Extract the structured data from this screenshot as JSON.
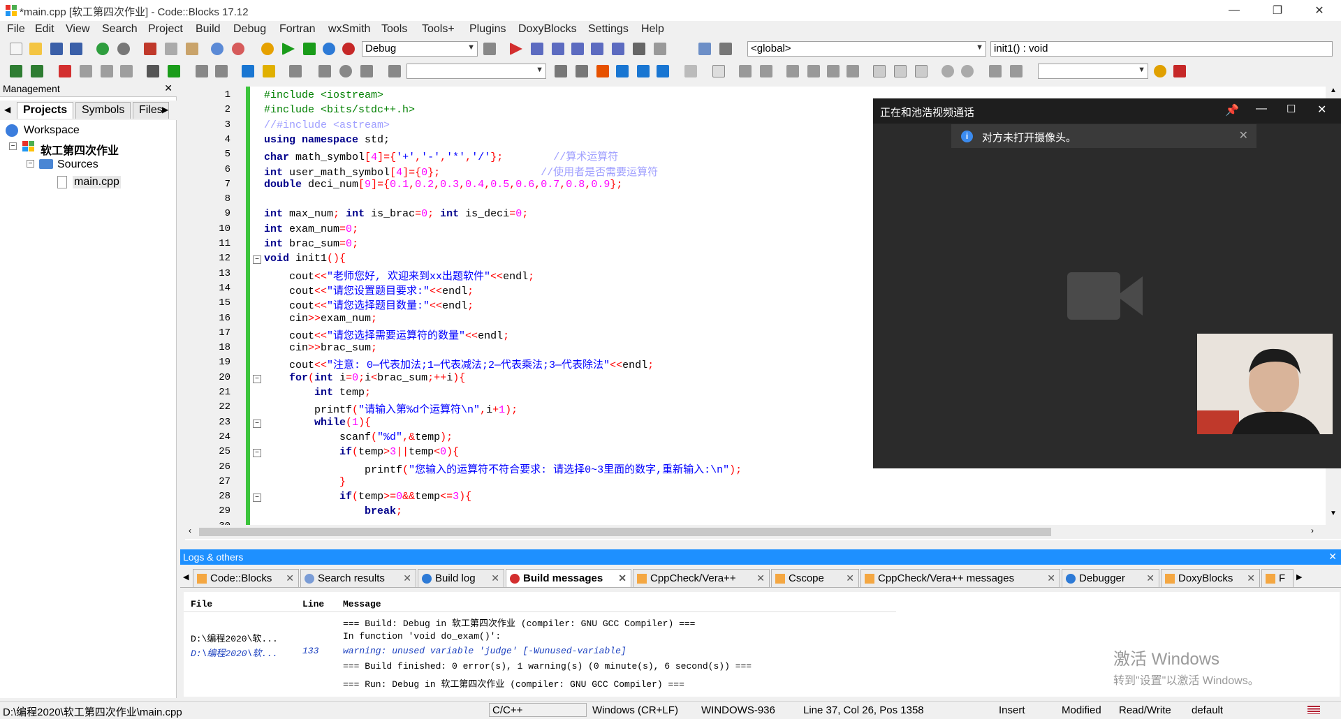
{
  "window": {
    "title": "*main.cpp [软工第四次作业] - Code::Blocks 17.12",
    "minimize": "—",
    "maximize": "❐",
    "close": "✕"
  },
  "menu": [
    "File",
    "Edit",
    "View",
    "Search",
    "Project",
    "Build",
    "Debug",
    "Fortran",
    "wxSmith",
    "Tools",
    "Tools+",
    "Plugins",
    "DoxyBlocks",
    "Settings",
    "Help"
  ],
  "toolbar": {
    "build_target": "Debug",
    "scope": "<global>",
    "symbol": "init1() : void"
  },
  "management": {
    "title": "Management",
    "tabs": [
      "Projects",
      "Symbols",
      "Files"
    ],
    "tree": {
      "workspace": "Workspace",
      "project": "软工第四次作业",
      "sources": "Sources",
      "file": "main.cpp"
    }
  },
  "editor": {
    "lines": [
      {
        "n": "1",
        "html": "<span class=\"pp\">#include &lt;iostream&gt;</span>"
      },
      {
        "n": "2",
        "html": "<span class=\"pp\">#include &lt;bits/stdc++.h&gt;</span>"
      },
      {
        "n": "3",
        "html": "<span class=\"cm\">//#include &lt;astream&gt;</span>"
      },
      {
        "n": "4",
        "html": "<span class=\"kw\">using namespace</span> std;"
      },
      {
        "n": "5",
        "html": "<span class=\"kw\">char</span> math_symbol<span class=\"op\">[</span><span class=\"num\">4</span><span class=\"op\">]={</span><span class=\"str\">'+'</span><span class=\"op\">,</span><span class=\"str\">'-'</span><span class=\"op\">,</span><span class=\"str\">'*'</span><span class=\"op\">,</span><span class=\"str\">'/'</span><span class=\"op\">};</span>        <span class=\"cm\">//算术运算符</span>"
      },
      {
        "n": "6",
        "html": "<span class=\"kw\">int</span> user_math_symbol<span class=\"op\">[</span><span class=\"num\">4</span><span class=\"op\">]={</span><span class=\"num\">0</span><span class=\"op\">};</span>                <span class=\"cm\">//使用者是否需要运算符</span>"
      },
      {
        "n": "7",
        "html": "<span class=\"kw\">double</span> deci_num<span class=\"op\">[</span><span class=\"num\">9</span><span class=\"op\">]={</span><span class=\"num\">0.1</span><span class=\"op\">,</span><span class=\"num\">0.2</span><span class=\"op\">,</span><span class=\"num\">0.3</span><span class=\"op\">,</span><span class=\"num\">0.4</span><span class=\"op\">,</span><span class=\"num\">0.5</span><span class=\"op\">,</span><span class=\"num\">0.6</span><span class=\"op\">,</span><span class=\"num\">0.7</span><span class=\"op\">,</span><span class=\"num\">0.8</span><span class=\"op\">,</span><span class=\"num\">0.9</span><span class=\"op\">};</span>"
      },
      {
        "n": "8",
        "html": ""
      },
      {
        "n": "9",
        "html": "<span class=\"kw\">int</span> max_num<span class=\"op\">;</span> <span class=\"kw\">int</span> is_brac<span class=\"op\">=</span><span class=\"num\">0</span><span class=\"op\">;</span> <span class=\"kw\">int</span> is_deci<span class=\"op\">=</span><span class=\"num\">0</span><span class=\"op\">;</span>"
      },
      {
        "n": "10",
        "html": "<span class=\"kw\">int</span> exam_num<span class=\"op\">=</span><span class=\"num\">0</span><span class=\"op\">;</span>"
      },
      {
        "n": "11",
        "html": "<span class=\"kw\">int</span> brac_sum<span class=\"op\">=</span><span class=\"num\">0</span><span class=\"op\">;</span>"
      },
      {
        "n": "12",
        "html": "<span class=\"kw\">void</span> init1<span class=\"op\">(){</span>"
      },
      {
        "n": "13",
        "html": "    cout<span class=\"op\">&lt;&lt;</span><span class=\"str\">\"老师您好, 欢迎来到xx出题软件\"</span><span class=\"op\">&lt;&lt;</span>endl<span class=\"op\">;</span>"
      },
      {
        "n": "14",
        "html": "    cout<span class=\"op\">&lt;&lt;</span><span class=\"str\">\"请您设置题目要求:\"</span><span class=\"op\">&lt;&lt;</span>endl<span class=\"op\">;</span>"
      },
      {
        "n": "15",
        "html": "    cout<span class=\"op\">&lt;&lt;</span><span class=\"str\">\"请您选择题目数量:\"</span><span class=\"op\">&lt;&lt;</span>endl<span class=\"op\">;</span>"
      },
      {
        "n": "16",
        "html": "    cin<span class=\"op\">&gt;&gt;</span>exam_num<span class=\"op\">;</span>"
      },
      {
        "n": "17",
        "html": "    cout<span class=\"op\">&lt;&lt;</span><span class=\"str\">\"请您选择需要运算符的数量\"</span><span class=\"op\">&lt;&lt;</span>endl<span class=\"op\">;</span>"
      },
      {
        "n": "18",
        "html": "    cin<span class=\"op\">&gt;&gt;</span>brac_sum<span class=\"op\">;</span>"
      },
      {
        "n": "19",
        "html": "    cout<span class=\"op\">&lt;&lt;</span><span class=\"str\">\"注意: 0—代表加法;1—代表减法;2—代表乘法;3—代表除法\"</span><span class=\"op\">&lt;&lt;</span>endl<span class=\"op\">;</span>"
      },
      {
        "n": "20",
        "html": "    <span class=\"kw\">for</span><span class=\"op\">(</span><span class=\"kw\">int</span> i<span class=\"op\">=</span><span class=\"num\">0</span><span class=\"op\">;</span>i<span class=\"op\">&lt;</span>brac_sum<span class=\"op\">;++</span>i<span class=\"op\">){</span>"
      },
      {
        "n": "21",
        "html": "        <span class=\"kw\">int</span> temp<span class=\"op\">;</span>"
      },
      {
        "n": "22",
        "html": "        printf<span class=\"op\">(</span><span class=\"str\">\"请输入第%d个运算符\\n\"</span><span class=\"op\">,</span>i<span class=\"op\">+</span><span class=\"num\">1</span><span class=\"op\">);</span>"
      },
      {
        "n": "23",
        "html": "        <span class=\"kw\">while</span><span class=\"op\">(</span><span class=\"num\">1</span><span class=\"op\">){</span>"
      },
      {
        "n": "24",
        "html": "            scanf<span class=\"op\">(</span><span class=\"str\">\"%d\"</span><span class=\"op\">,&amp;</span>temp<span class=\"op\">);</span>"
      },
      {
        "n": "25",
        "html": "            <span class=\"kw\">if</span><span class=\"op\">(</span>temp<span class=\"op\">&gt;</span><span class=\"num\">3</span><span class=\"op\">||</span>temp<span class=\"op\">&lt;</span><span class=\"num\">0</span><span class=\"op\">){</span>"
      },
      {
        "n": "26",
        "html": "                printf<span class=\"op\">(</span><span class=\"str\">\"您输入的运算符不符合要求: 请选择0~3里面的数字,重新输入:\\n\"</span><span class=\"op\">);</span>"
      },
      {
        "n": "27",
        "html": "            <span class=\"op\">}</span>"
      },
      {
        "n": "28",
        "html": "            <span class=\"kw\">if</span><span class=\"op\">(</span>temp<span class=\"op\">&gt;=</span><span class=\"num\">0</span><span class=\"op\">&amp;&amp;</span>temp<span class=\"op\">&lt;=</span><span class=\"num\">3</span><span class=\"op\">){</span>"
      },
      {
        "n": "29",
        "html": "                <span class=\"kw\">break</span><span class=\"op\">;</span>"
      },
      {
        "n": "30",
        "html": ""
      }
    ]
  },
  "video_call": {
    "title": "正在和池浩视频通话",
    "notice": "对方未打开摄像头。"
  },
  "logs": {
    "title": "Logs & others",
    "tabs": [
      "Code::Blocks",
      "Search results",
      "Build log",
      "Build messages",
      "CppCheck/Vera++",
      "Cscope",
      "CppCheck/Vera++ messages",
      "Debugger",
      "DoxyBlocks",
      "F"
    ],
    "columns": [
      "File",
      "Line",
      "Message"
    ],
    "rows": [
      {
        "file": "",
        "line": "",
        "msg": "=== Build: Debug in 软工第四次作业 (compiler: GNU GCC Compiler) ==="
      },
      {
        "file": "D:\\编程2020\\软...",
        "line": "",
        "msg": "In function 'void do_exam()':"
      },
      {
        "file": "D:\\编程2020\\软...",
        "line": "133",
        "msg": "warning: unused variable 'judge' [-Wunused-variable]"
      },
      {
        "file": "",
        "line": "",
        "msg": "=== Build finished: 0 error(s), 1 warning(s) (0 minute(s), 6 second(s)) ==="
      },
      {
        "file": "",
        "line": "",
        "msg": "=== Run: Debug in 软工第四次作业 (compiler: GNU GCC Compiler) ==="
      }
    ]
  },
  "watermark": {
    "line1": "激活 Windows",
    "line2": "转到\"设置\"以激活 Windows。"
  },
  "status": {
    "path": "D:\\编程2020\\软工第四次作业\\main.cpp",
    "lang": "C/C++",
    "eol": "Windows (CR+LF)",
    "encoding": "WINDOWS-936",
    "position": "Line 37, Col 26, Pos 1358",
    "mode": "Insert",
    "modified": "Modified",
    "rw": "Read/Write",
    "profile": "default"
  }
}
